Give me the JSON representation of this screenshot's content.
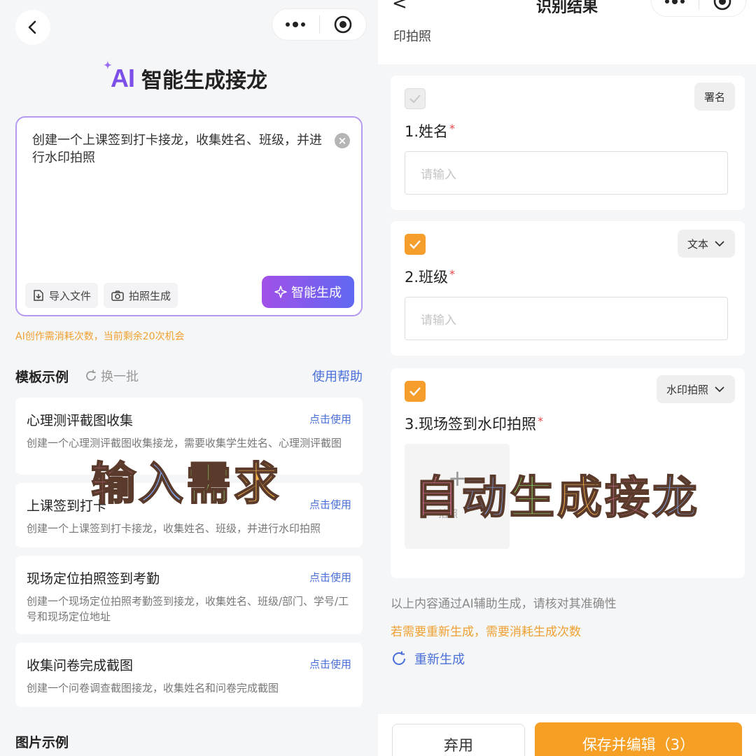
{
  "left": {
    "ai_mark": "AI",
    "title": "智能生成接龙",
    "input_text": "创建一个上课签到打卡接龙，收集姓名、班级，并进行水印拍照",
    "clear_symbol": "×",
    "import_label": "导入文件",
    "photo_gen_label": "拍照生成",
    "generate_label": "智能生成",
    "quota_note": "AI创作需消耗次数，当前剩余20次机会",
    "templates_title": "模板示例",
    "refresh_label": "换一批",
    "help_label": "使用帮助",
    "templates": [
      {
        "name": "心理测评截图收集",
        "use": "点击使用",
        "desc": "创建一个心理测评截图收集接龙，需要收集学生姓名、心理测评截图"
      },
      {
        "name": "上课签到打卡",
        "use": "点击使用",
        "desc": "创建一个上课签到打卡接龙，收集姓名、班级，并进行水印拍照"
      },
      {
        "name": "现场定位拍照签到考勤",
        "use": "点击使用",
        "desc": "创建一个现场定位拍照考勤签到接龙，收集姓名、班级/部门、学号/工号和现场定位地址"
      },
      {
        "name": "收集问卷完成截图",
        "use": "点击使用",
        "desc": "创建一个问卷调查截图接龙，收集姓名和问卷完成截图"
      }
    ],
    "image_examples_title": "图片示例",
    "overlay_text": "输入需求"
  },
  "right": {
    "back_symbol": "<",
    "title": "识别结果",
    "subtitle": "印拍照",
    "fields": [
      {
        "tag": "署名",
        "label": "1.姓名",
        "required": "*",
        "placeholder": "请输入",
        "checked": false
      },
      {
        "tag": "文本",
        "label": "2.班级",
        "required": "*",
        "placeholder": "请输入",
        "checked": true
      },
      {
        "tag": "水印拍照",
        "label": "3.现场签到水印拍照",
        "required": "*",
        "photo_label": "拍照",
        "checked": true
      }
    ],
    "ai_note": "以上内容通过AI辅助生成，请核对其准确性",
    "regen_note": "若需要重新生成，需要消耗生成次数",
    "regen_label": "重新生成",
    "discard_label": "弃用",
    "save_label": "保存并编辑（3）",
    "overlay_text": "自动生成接龙"
  },
  "colors": {
    "accent_purple": "#7b4fe8",
    "accent_orange": "#f59e2b",
    "link_blue": "#4a6fd8",
    "warning_orange": "#f0a030"
  }
}
